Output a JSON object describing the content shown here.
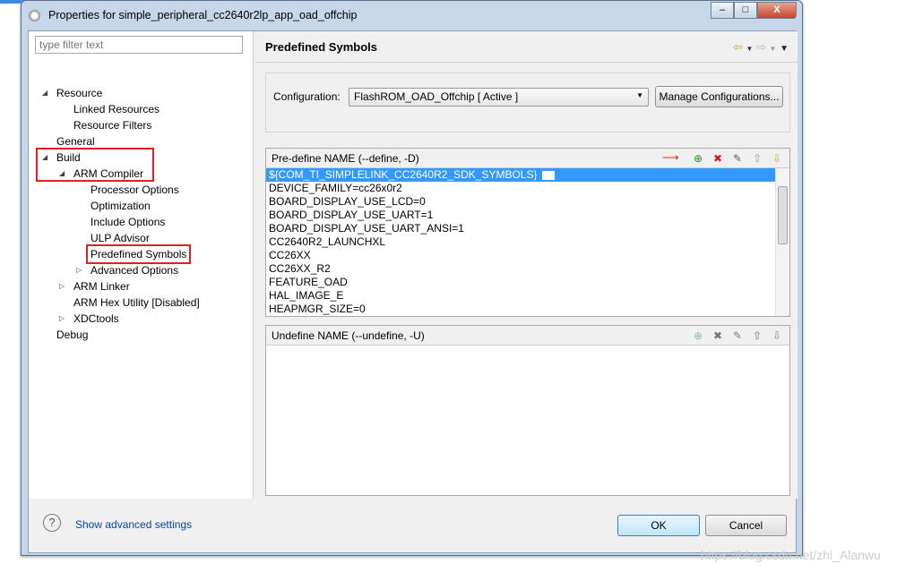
{
  "window": {
    "title": "Properties for simple_peripheral_cc2640r2lp_app_oad_offchip",
    "controls": [
      "minimize",
      "maximize",
      "close"
    ]
  },
  "filter": {
    "placeholder": "type filter text"
  },
  "tree": [
    {
      "label": "Resource",
      "level": 0,
      "expanded": true
    },
    {
      "label": "Linked Resources",
      "level": 1
    },
    {
      "label": "Resource Filters",
      "level": 1
    },
    {
      "label": "General",
      "level": 0
    },
    {
      "label": "Build",
      "level": 0,
      "expanded": true,
      "highlighted": true
    },
    {
      "label": "ARM Compiler",
      "level": 1,
      "expanded": true,
      "highlighted": true
    },
    {
      "label": "Processor Options",
      "level": 2
    },
    {
      "label": "Optimization",
      "level": 2
    },
    {
      "label": "Include Options",
      "level": 2
    },
    {
      "label": "ULP Advisor",
      "level": 2
    },
    {
      "label": "Predefined Symbols",
      "level": 2,
      "selected": true,
      "highlighted": true
    },
    {
      "label": "Advanced Options",
      "level": 2,
      "collapsed": true
    },
    {
      "label": "ARM Linker",
      "level": 1,
      "collapsed": true
    },
    {
      "label": "ARM Hex Utility  [Disabled]",
      "level": 1
    },
    {
      "label": "XDCtools",
      "level": 1,
      "collapsed": true
    },
    {
      "label": "Debug",
      "level": 0
    }
  ],
  "page": {
    "title": "Predefined Symbols"
  },
  "config": {
    "label": "Configuration:",
    "value": "FlashROM_OAD_Offchip  [ Active ]",
    "manage": "Manage Configurations..."
  },
  "predefine": {
    "header": "Pre-define NAME (--define, -D)",
    "items": [
      "${COM_TI_SIMPLELINK_CC2640R2_SDK_SYMBOLS}",
      "DEVICE_FAMILY=cc26x0r2",
      "BOARD_DISPLAY_USE_LCD=0",
      "BOARD_DISPLAY_USE_UART=1",
      "BOARD_DISPLAY_USE_UART_ANSI=1",
      "CC2640R2_LAUNCHXL",
      "CC26XX",
      "CC26XX_R2",
      "FEATURE_OAD",
      "HAL_IMAGE_E",
      "HEAPMGR_SIZE=0"
    ]
  },
  "undefine": {
    "header": "Undefine NAME (--undefine, -U)",
    "items": []
  },
  "footer": {
    "advanced": "Show advanced settings",
    "ok": "OK",
    "cancel": "Cancel"
  },
  "watermark": "https://blog.csdn.net/zhi_Alanwu",
  "colors": {
    "selection": "#3399ff",
    "highlight_box": "#e02020",
    "link": "#0645ad"
  }
}
